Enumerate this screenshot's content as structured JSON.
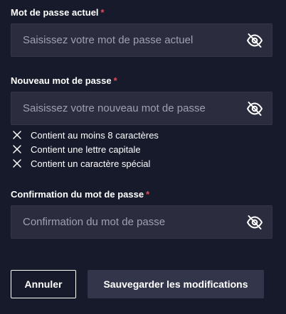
{
  "current_password": {
    "label": "Mot de passe actuel",
    "required_marker": "*",
    "placeholder": "Saisissez votre mot de passe actuel",
    "value": "",
    "visibility_icon": "eye-slash-icon"
  },
  "new_password": {
    "label": "Nouveau mot de passe",
    "required_marker": "*",
    "placeholder": "Saisissez votre nouveau mot de passe",
    "value": "",
    "visibility_icon": "eye-slash-icon",
    "rules": [
      {
        "text": "Contient au moins 8 caractères",
        "status": "unmet",
        "icon": "x-icon"
      },
      {
        "text": "Contient une lettre capitale",
        "status": "unmet",
        "icon": "x-icon"
      },
      {
        "text": "Contient un caractère spécial",
        "status": "unmet",
        "icon": "x-icon"
      }
    ]
  },
  "confirm_password": {
    "label": "Confirmation du mot de passe",
    "required_marker": "*",
    "placeholder": "Confirmation du mot de passe",
    "value": "",
    "visibility_icon": "eye-slash-icon"
  },
  "actions": {
    "cancel_label": "Annuler",
    "save_label": "Sauvegarder les modifications"
  },
  "colors": {
    "background": "#171a2b",
    "input_background": "#2b2d3f",
    "required_marker": "#e24a5a",
    "placeholder_text": "#9ea1af",
    "save_button_background": "#33364a",
    "text": "#ffffff"
  }
}
